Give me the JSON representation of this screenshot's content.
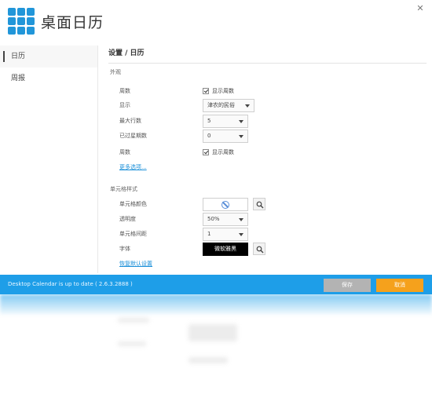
{
  "app": {
    "title": "桌面日历"
  },
  "sidebar": {
    "items": [
      {
        "label": "日历",
        "active": true
      },
      {
        "label": "周报",
        "active": false
      }
    ]
  },
  "breadcrumb": "设置 / 日历",
  "sections": {
    "appearance": {
      "title": "外观",
      "week_row": {
        "label": "周数",
        "checkbox_label": "显示周数",
        "checked": true
      },
      "display_row": {
        "label": "显示",
        "value": "津农的民俗"
      },
      "max_rows": {
        "label": "最大行数",
        "value": "5"
      },
      "weeks_row": {
        "label": "已过星期数",
        "value": "0"
      },
      "day_row": {
        "label": "周数",
        "checkbox_label": "显示周数",
        "checked": true
      },
      "more_link": "更多选项..."
    },
    "cell_style": {
      "title": "单元格样式",
      "cell_color": {
        "label": "单元格颜色"
      },
      "opacity": {
        "label": "透明度",
        "value": "50%"
      },
      "cell_spacing": {
        "label": "单元格间距",
        "value": "1"
      },
      "font": {
        "label": "字体",
        "value": "微软雅黑"
      },
      "reset_link": "恢复默认设置"
    }
  },
  "footer": {
    "status": "Desktop Calendar is up to date ( 2.6.3.2888 )",
    "cancel_label": "保存",
    "ok_label": "取消"
  },
  "colors": {
    "accent": "#1e9ee8",
    "logo": "#2196d9",
    "orange_button": "#f5a11c",
    "gray_button": "#b3b3b3"
  },
  "icons": {
    "logo": "grid-logo-icon",
    "close": "close-icon",
    "color_picker": "magnifier-icon",
    "font_picker": "magnifier-icon",
    "no_color": "no-color-icon"
  }
}
